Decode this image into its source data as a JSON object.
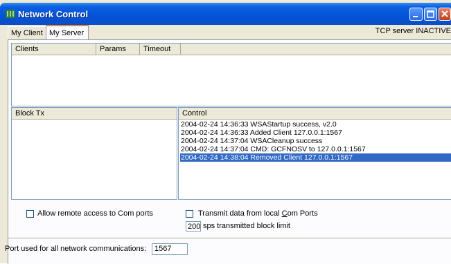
{
  "window": {
    "title": "Network Control"
  },
  "tabs": [
    {
      "label": "My Client"
    },
    {
      "label": "My Server"
    }
  ],
  "status": {
    "text": "TCP server INACTIVE"
  },
  "clients_table": {
    "columns": [
      "Clients",
      "Params",
      "Timeout"
    ],
    "rows": []
  },
  "block_tx": {
    "header": "Block Tx"
  },
  "control": {
    "header": "Control",
    "log": [
      "2004-02-24 14:36:33  WSAStartup success, v2.0",
      "2004-02-24 14:36:33  Added Client 127.0.0.1:1567",
      "2004-02-24 14:37:04  WSACleanup success",
      "2004-02-24 14:37:04  CMD: GCFNOSV to 127.0.0.1:1567",
      "2004-02-24 14:38:04  Removed Client 127.0.0.1:1567"
    ],
    "selected_index": 4
  },
  "options": {
    "remote_access_label": "Allow remote access to Com ports",
    "remote_access_checked": false,
    "transmit_label_pre": "Transmit data from local ",
    "transmit_label_accel": "C",
    "transmit_label_post": "om Ports",
    "transmit_checked": false,
    "block_limit_value": "200",
    "block_limit_label": "sps transmitted block limit"
  },
  "port": {
    "label": "Port used for all network communications:",
    "value": "1567"
  },
  "colors": {
    "title_bar": "#0453d6",
    "selection": "#316ac5",
    "tab_highlight": "#e68b2c",
    "face": "#ece9d8"
  }
}
